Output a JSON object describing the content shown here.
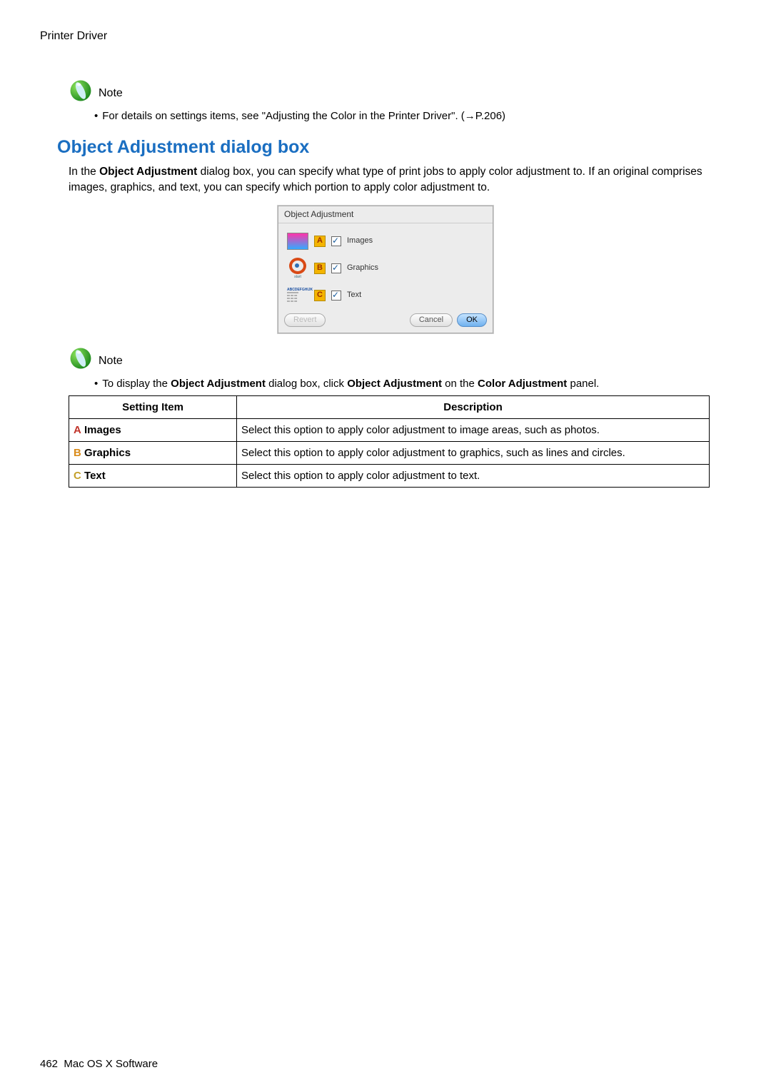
{
  "header": "Printer Driver",
  "note1": {
    "label": "Note",
    "bullet": "For details on settings items, see \"Adjusting the Color in the Printer Driver\". (→P.206)"
  },
  "section_heading": "Object Adjustment dialog box",
  "intro": {
    "prefix": "In the ",
    "bold1": "Object Adjustment",
    "rest": " dialog box, you can specify what type of print jobs to apply color adjustment to. If an original comprises images, graphics, and text, you can specify which portion to apply color adjustment to."
  },
  "dialog": {
    "title": "Object Adjustment",
    "items": [
      {
        "marker": "A",
        "label": "Images"
      },
      {
        "marker": "B",
        "label": "Graphics"
      },
      {
        "marker": "C",
        "label": "Text"
      }
    ],
    "buttons": {
      "revert": "Revert",
      "cancel": "Cancel",
      "ok": "OK"
    }
  },
  "note2": {
    "label": "Note",
    "bullet_parts": {
      "p1": "To display the ",
      "b1": "Object Adjustment",
      "p2": " dialog box, click ",
      "b2": "Object Adjustment",
      "p3": " on the ",
      "b3": "Color Adjustment",
      "p4": " panel."
    }
  },
  "table": {
    "headers": {
      "setting": "Setting Item",
      "description": "Description"
    },
    "rows": [
      {
        "letter": "A",
        "letter_class": "a",
        "name": "Images",
        "desc": "Select this option to apply color adjustment to image areas, such as photos."
      },
      {
        "letter": "B",
        "letter_class": "b",
        "name": "Graphics",
        "desc": "Select this option to apply color adjustment to graphics, such as lines and circles."
      },
      {
        "letter": "C",
        "letter_class": "c",
        "name": "Text",
        "desc": "Select this option to apply color adjustment to text."
      }
    ]
  },
  "footer": {
    "page_number": "462",
    "section": "Mac OS X Software"
  }
}
